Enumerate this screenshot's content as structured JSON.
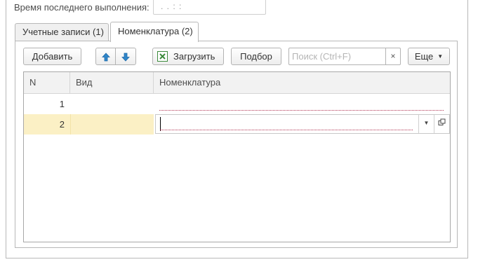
{
  "header": {
    "last_run_label": "Время последнего выполнения:",
    "last_run_value": ".   .        :   :"
  },
  "tabs": [
    {
      "label": "Учетные записи (1)",
      "active": false
    },
    {
      "label": "Номенклатура (2)",
      "active": true
    }
  ],
  "toolbar": {
    "add_label": "Добавить",
    "up_icon": "arrow-up-icon",
    "down_icon": "arrow-down-icon",
    "load_label": "Загрузить",
    "load_icon": "excel-icon",
    "select_label": "Подбор",
    "search_placeholder": "Поиск (Ctrl+F)",
    "search_clear": "×",
    "more_label": "Еще"
  },
  "table": {
    "columns": [
      "N",
      "Вид",
      "Номенклатура"
    ],
    "rows": [
      {
        "n": "1",
        "kind": "",
        "nomenclature": ""
      },
      {
        "n": "2",
        "kind": "",
        "nomenclature": ""
      }
    ]
  },
  "colors": {
    "accent_blue": "#2f86c9",
    "excel_green": "#3c8b3c",
    "selected_row": "#fbf0c5",
    "required_underline": "#b03050"
  }
}
